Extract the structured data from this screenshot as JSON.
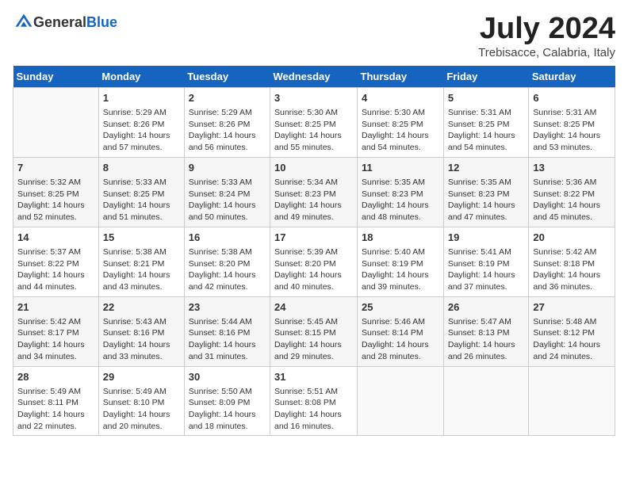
{
  "header": {
    "logo_general": "General",
    "logo_blue": "Blue",
    "title": "July 2024",
    "location": "Trebisacce, Calabria, Italy"
  },
  "columns": [
    "Sunday",
    "Monday",
    "Tuesday",
    "Wednesday",
    "Thursday",
    "Friday",
    "Saturday"
  ],
  "weeks": [
    [
      {
        "day": "",
        "sunrise": "",
        "sunset": "",
        "daylight": ""
      },
      {
        "day": "1",
        "sunrise": "Sunrise: 5:29 AM",
        "sunset": "Sunset: 8:26 PM",
        "daylight": "Daylight: 14 hours and 57 minutes."
      },
      {
        "day": "2",
        "sunrise": "Sunrise: 5:29 AM",
        "sunset": "Sunset: 8:26 PM",
        "daylight": "Daylight: 14 hours and 56 minutes."
      },
      {
        "day": "3",
        "sunrise": "Sunrise: 5:30 AM",
        "sunset": "Sunset: 8:25 PM",
        "daylight": "Daylight: 14 hours and 55 minutes."
      },
      {
        "day": "4",
        "sunrise": "Sunrise: 5:30 AM",
        "sunset": "Sunset: 8:25 PM",
        "daylight": "Daylight: 14 hours and 54 minutes."
      },
      {
        "day": "5",
        "sunrise": "Sunrise: 5:31 AM",
        "sunset": "Sunset: 8:25 PM",
        "daylight": "Daylight: 14 hours and 54 minutes."
      },
      {
        "day": "6",
        "sunrise": "Sunrise: 5:31 AM",
        "sunset": "Sunset: 8:25 PM",
        "daylight": "Daylight: 14 hours and 53 minutes."
      }
    ],
    [
      {
        "day": "7",
        "sunrise": "Sunrise: 5:32 AM",
        "sunset": "Sunset: 8:25 PM",
        "daylight": "Daylight: 14 hours and 52 minutes."
      },
      {
        "day": "8",
        "sunrise": "Sunrise: 5:33 AM",
        "sunset": "Sunset: 8:25 PM",
        "daylight": "Daylight: 14 hours and 51 minutes."
      },
      {
        "day": "9",
        "sunrise": "Sunrise: 5:33 AM",
        "sunset": "Sunset: 8:24 PM",
        "daylight": "Daylight: 14 hours and 50 minutes."
      },
      {
        "day": "10",
        "sunrise": "Sunrise: 5:34 AM",
        "sunset": "Sunset: 8:23 PM",
        "daylight": "Daylight: 14 hours and 49 minutes."
      },
      {
        "day": "11",
        "sunrise": "Sunrise: 5:35 AM",
        "sunset": "Sunset: 8:23 PM",
        "daylight": "Daylight: 14 hours and 48 minutes."
      },
      {
        "day": "12",
        "sunrise": "Sunrise: 5:35 AM",
        "sunset": "Sunset: 8:23 PM",
        "daylight": "Daylight: 14 hours and 47 minutes."
      },
      {
        "day": "13",
        "sunrise": "Sunrise: 5:36 AM",
        "sunset": "Sunset: 8:22 PM",
        "daylight": "Daylight: 14 hours and 45 minutes."
      }
    ],
    [
      {
        "day": "14",
        "sunrise": "Sunrise: 5:37 AM",
        "sunset": "Sunset: 8:22 PM",
        "daylight": "Daylight: 14 hours and 44 minutes."
      },
      {
        "day": "15",
        "sunrise": "Sunrise: 5:38 AM",
        "sunset": "Sunset: 8:21 PM",
        "daylight": "Daylight: 14 hours and 43 minutes."
      },
      {
        "day": "16",
        "sunrise": "Sunrise: 5:38 AM",
        "sunset": "Sunset: 8:20 PM",
        "daylight": "Daylight: 14 hours and 42 minutes."
      },
      {
        "day": "17",
        "sunrise": "Sunrise: 5:39 AM",
        "sunset": "Sunset: 8:20 PM",
        "daylight": "Daylight: 14 hours and 40 minutes."
      },
      {
        "day": "18",
        "sunrise": "Sunrise: 5:40 AM",
        "sunset": "Sunset: 8:19 PM",
        "daylight": "Daylight: 14 hours and 39 minutes."
      },
      {
        "day": "19",
        "sunrise": "Sunrise: 5:41 AM",
        "sunset": "Sunset: 8:19 PM",
        "daylight": "Daylight: 14 hours and 37 minutes."
      },
      {
        "day": "20",
        "sunrise": "Sunrise: 5:42 AM",
        "sunset": "Sunset: 8:18 PM",
        "daylight": "Daylight: 14 hours and 36 minutes."
      }
    ],
    [
      {
        "day": "21",
        "sunrise": "Sunrise: 5:42 AM",
        "sunset": "Sunset: 8:17 PM",
        "daylight": "Daylight: 14 hours and 34 minutes."
      },
      {
        "day": "22",
        "sunrise": "Sunrise: 5:43 AM",
        "sunset": "Sunset: 8:16 PM",
        "daylight": "Daylight: 14 hours and 33 minutes."
      },
      {
        "day": "23",
        "sunrise": "Sunrise: 5:44 AM",
        "sunset": "Sunset: 8:16 PM",
        "daylight": "Daylight: 14 hours and 31 minutes."
      },
      {
        "day": "24",
        "sunrise": "Sunrise: 5:45 AM",
        "sunset": "Sunset: 8:15 PM",
        "daylight": "Daylight: 14 hours and 29 minutes."
      },
      {
        "day": "25",
        "sunrise": "Sunrise: 5:46 AM",
        "sunset": "Sunset: 8:14 PM",
        "daylight": "Daylight: 14 hours and 28 minutes."
      },
      {
        "day": "26",
        "sunrise": "Sunrise: 5:47 AM",
        "sunset": "Sunset: 8:13 PM",
        "daylight": "Daylight: 14 hours and 26 minutes."
      },
      {
        "day": "27",
        "sunrise": "Sunrise: 5:48 AM",
        "sunset": "Sunset: 8:12 PM",
        "daylight": "Daylight: 14 hours and 24 minutes."
      }
    ],
    [
      {
        "day": "28",
        "sunrise": "Sunrise: 5:49 AM",
        "sunset": "Sunset: 8:11 PM",
        "daylight": "Daylight: 14 hours and 22 minutes."
      },
      {
        "day": "29",
        "sunrise": "Sunrise: 5:49 AM",
        "sunset": "Sunset: 8:10 PM",
        "daylight": "Daylight: 14 hours and 20 minutes."
      },
      {
        "day": "30",
        "sunrise": "Sunrise: 5:50 AM",
        "sunset": "Sunset: 8:09 PM",
        "daylight": "Daylight: 14 hours and 18 minutes."
      },
      {
        "day": "31",
        "sunrise": "Sunrise: 5:51 AM",
        "sunset": "Sunset: 8:08 PM",
        "daylight": "Daylight: 14 hours and 16 minutes."
      },
      {
        "day": "",
        "sunrise": "",
        "sunset": "",
        "daylight": ""
      },
      {
        "day": "",
        "sunrise": "",
        "sunset": "",
        "daylight": ""
      },
      {
        "day": "",
        "sunrise": "",
        "sunset": "",
        "daylight": ""
      }
    ]
  ]
}
